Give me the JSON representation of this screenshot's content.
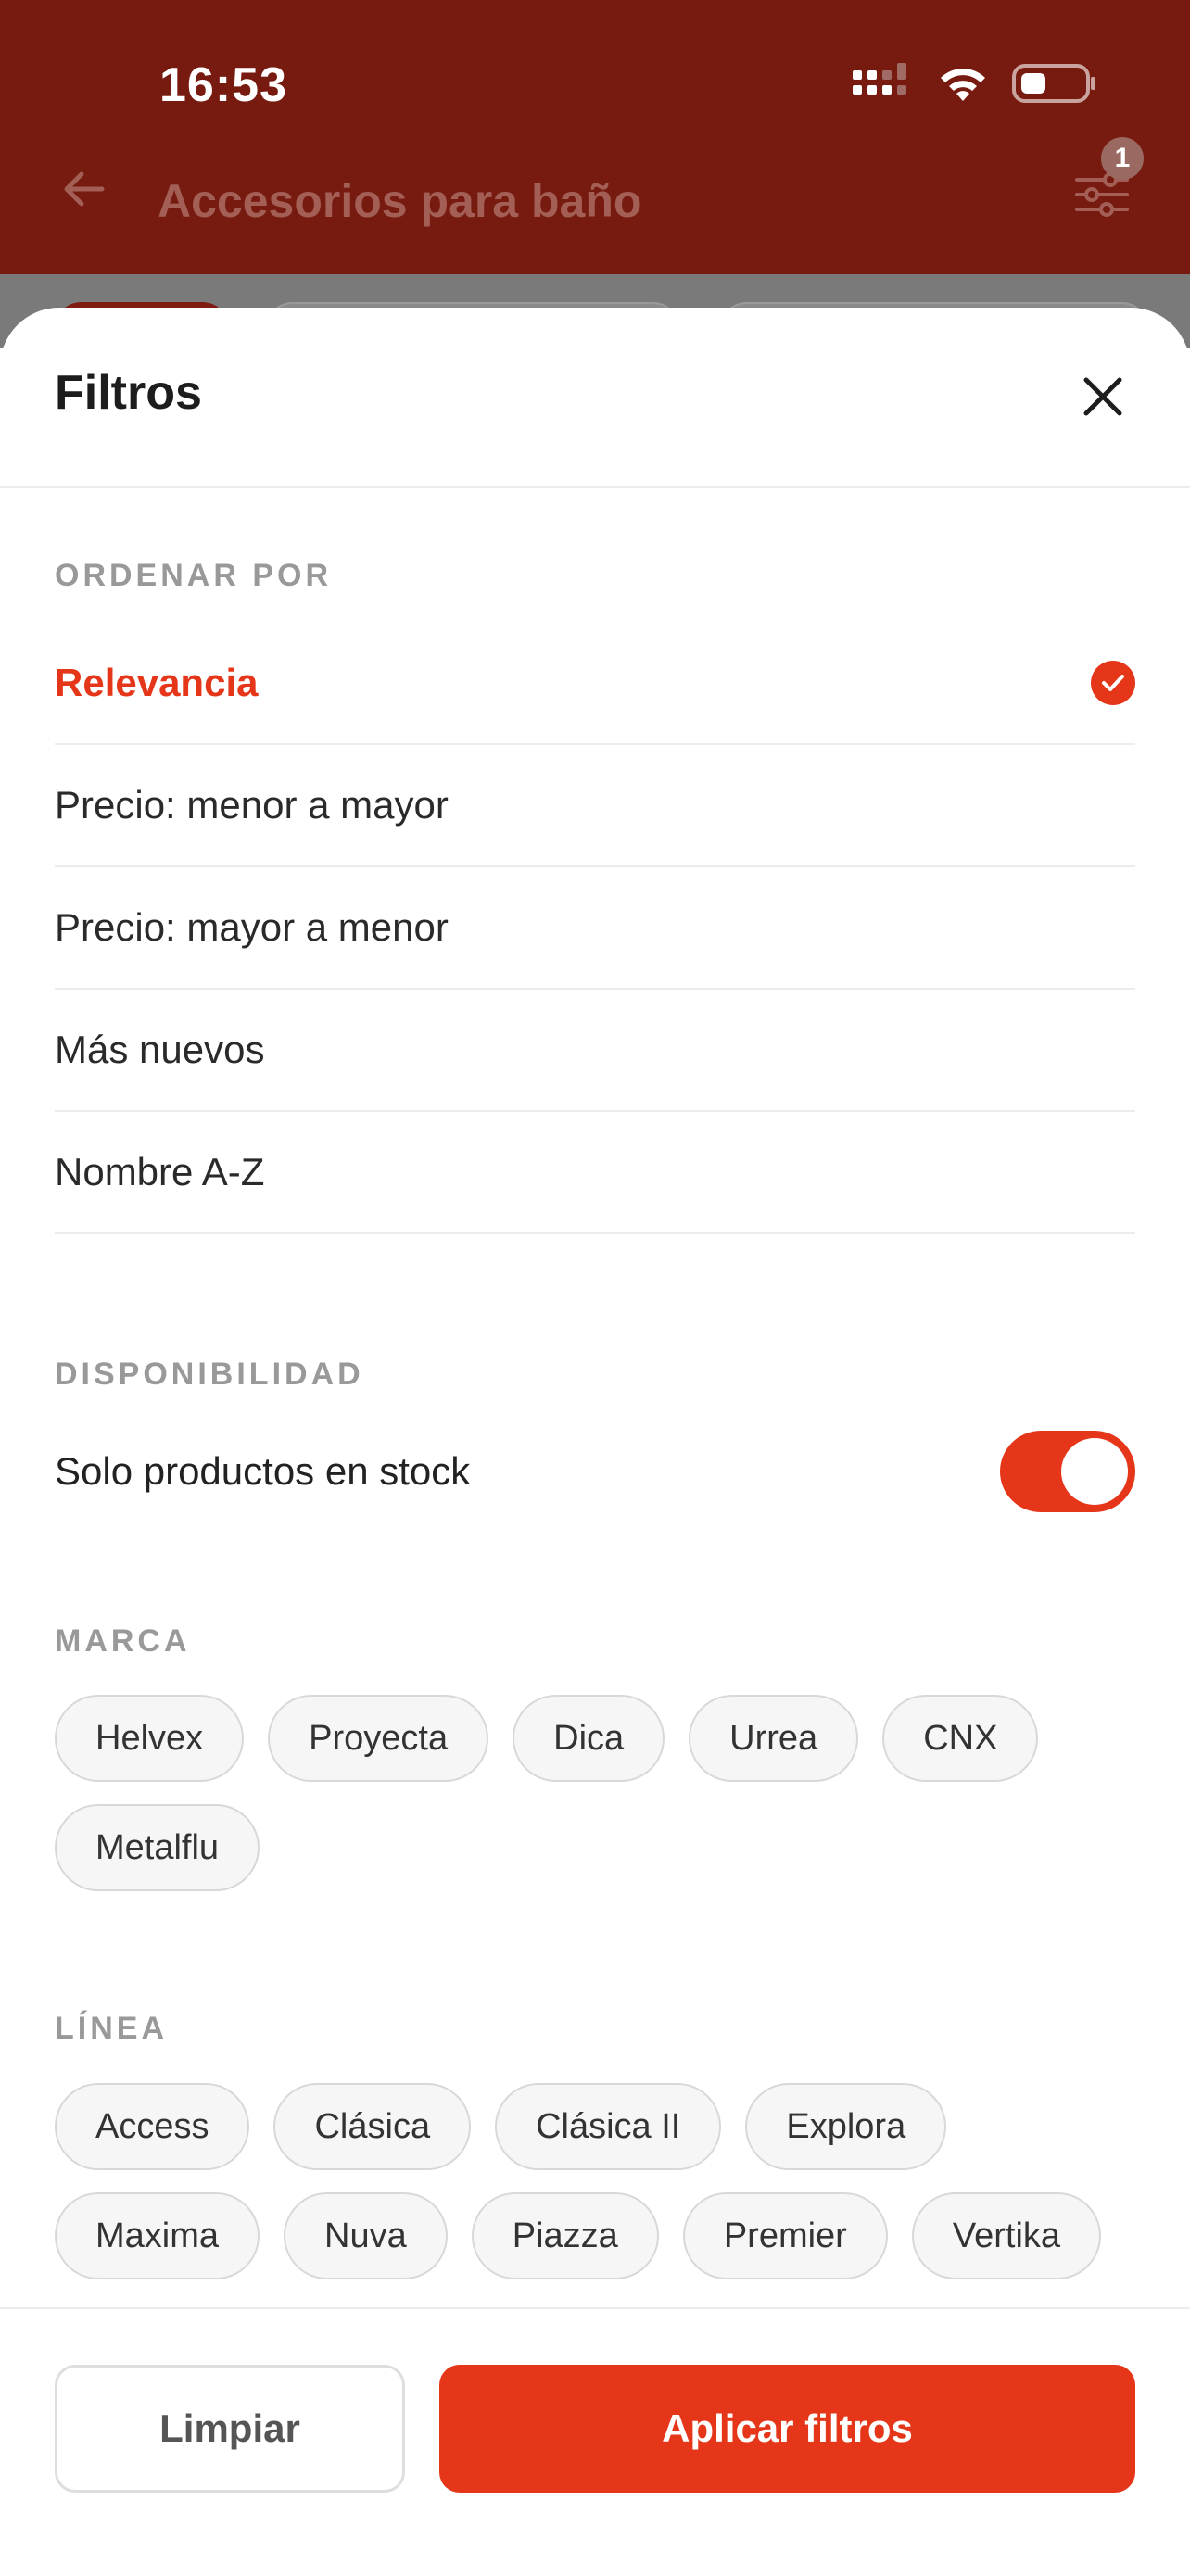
{
  "status_bar": {
    "time": "16:53"
  },
  "header": {
    "title": "Accesorios para baño",
    "filter_badge": "1"
  },
  "sheet": {
    "title": "Filtros",
    "sort": {
      "label": "ORDENAR POR",
      "options": [
        {
          "label": "Relevancia",
          "selected": true
        },
        {
          "label": "Precio: menor a mayor",
          "selected": false
        },
        {
          "label": "Precio: mayor a menor",
          "selected": false
        },
        {
          "label": "Más nuevos",
          "selected": false
        },
        {
          "label": "Nombre A-Z",
          "selected": false
        }
      ]
    },
    "availability": {
      "label": "DISPONIBILIDAD",
      "stock_only_label": "Solo productos en stock",
      "stock_only_enabled": true
    },
    "brand": {
      "label": "MARCA",
      "chips": [
        "Helvex",
        "Proyecta",
        "Dica",
        "Urrea",
        "CNX",
        "Metalflu"
      ]
    },
    "line": {
      "label": "LÍNEA",
      "chips": [
        "Access",
        "Clásica",
        "Clásica II",
        "Explora",
        "Maxima",
        "Nuva",
        "Piazza",
        "Premier",
        "Vertika"
      ]
    }
  },
  "footer": {
    "clear_label": "Limpiar",
    "apply_label": "Aplicar filtros"
  },
  "colors": {
    "accent": "#e5361a",
    "header_dim": "#771a0f"
  }
}
